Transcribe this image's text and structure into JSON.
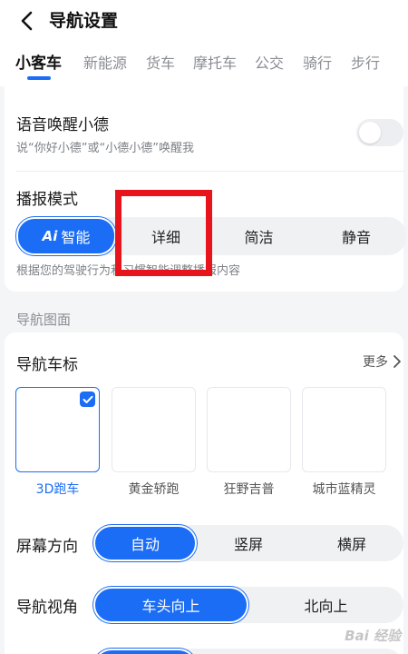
{
  "header": {
    "back_icon": "chevron-left-icon",
    "title": "导航设置"
  },
  "tabs": [
    {
      "label": "小客车",
      "active": true
    },
    {
      "label": "新能源",
      "active": false
    },
    {
      "label": "货车",
      "active": false
    },
    {
      "label": "摩托车",
      "active": false
    },
    {
      "label": "公交",
      "active": false
    },
    {
      "label": "骑行",
      "active": false
    },
    {
      "label": "步行",
      "active": false
    }
  ],
  "voice_wake": {
    "title": "语音唤醒小德",
    "subtitle": "说“你好小德”或“小德小德”唤醒我",
    "enabled": false
  },
  "broadcast": {
    "title": "播报模式",
    "options": [
      {
        "label": "智能",
        "badge": "Ai",
        "active": true
      },
      {
        "label": "详细",
        "active": false
      },
      {
        "label": "简洁",
        "active": false
      },
      {
        "label": "静音",
        "active": false
      }
    ],
    "description": "根据您的驾驶行为和习惯智能调整播报内容"
  },
  "section_label": "导航图面",
  "car_icon": {
    "title": "导航车标",
    "more_label": "更多",
    "items": [
      {
        "label": "3D跑车",
        "selected": true
      },
      {
        "label": "黄金轿跑",
        "selected": false
      },
      {
        "label": "狂野吉普",
        "selected": false
      },
      {
        "label": "城市蓝精灵",
        "selected": false
      }
    ]
  },
  "orientation": {
    "title": "屏幕方向",
    "options": [
      {
        "label": "自动",
        "active": true
      },
      {
        "label": "竖屏",
        "active": false
      },
      {
        "label": "横屏",
        "active": false
      }
    ]
  },
  "view_angle": {
    "title": "导航视角",
    "options": [
      {
        "label": "车头向上",
        "active": true
      },
      {
        "label": "北向上",
        "active": false
      }
    ]
  },
  "watermark": "Bai 经验",
  "colors": {
    "accent": "#1b6df5",
    "highlight": "#e8141c",
    "background": "#f4f5f7"
  }
}
